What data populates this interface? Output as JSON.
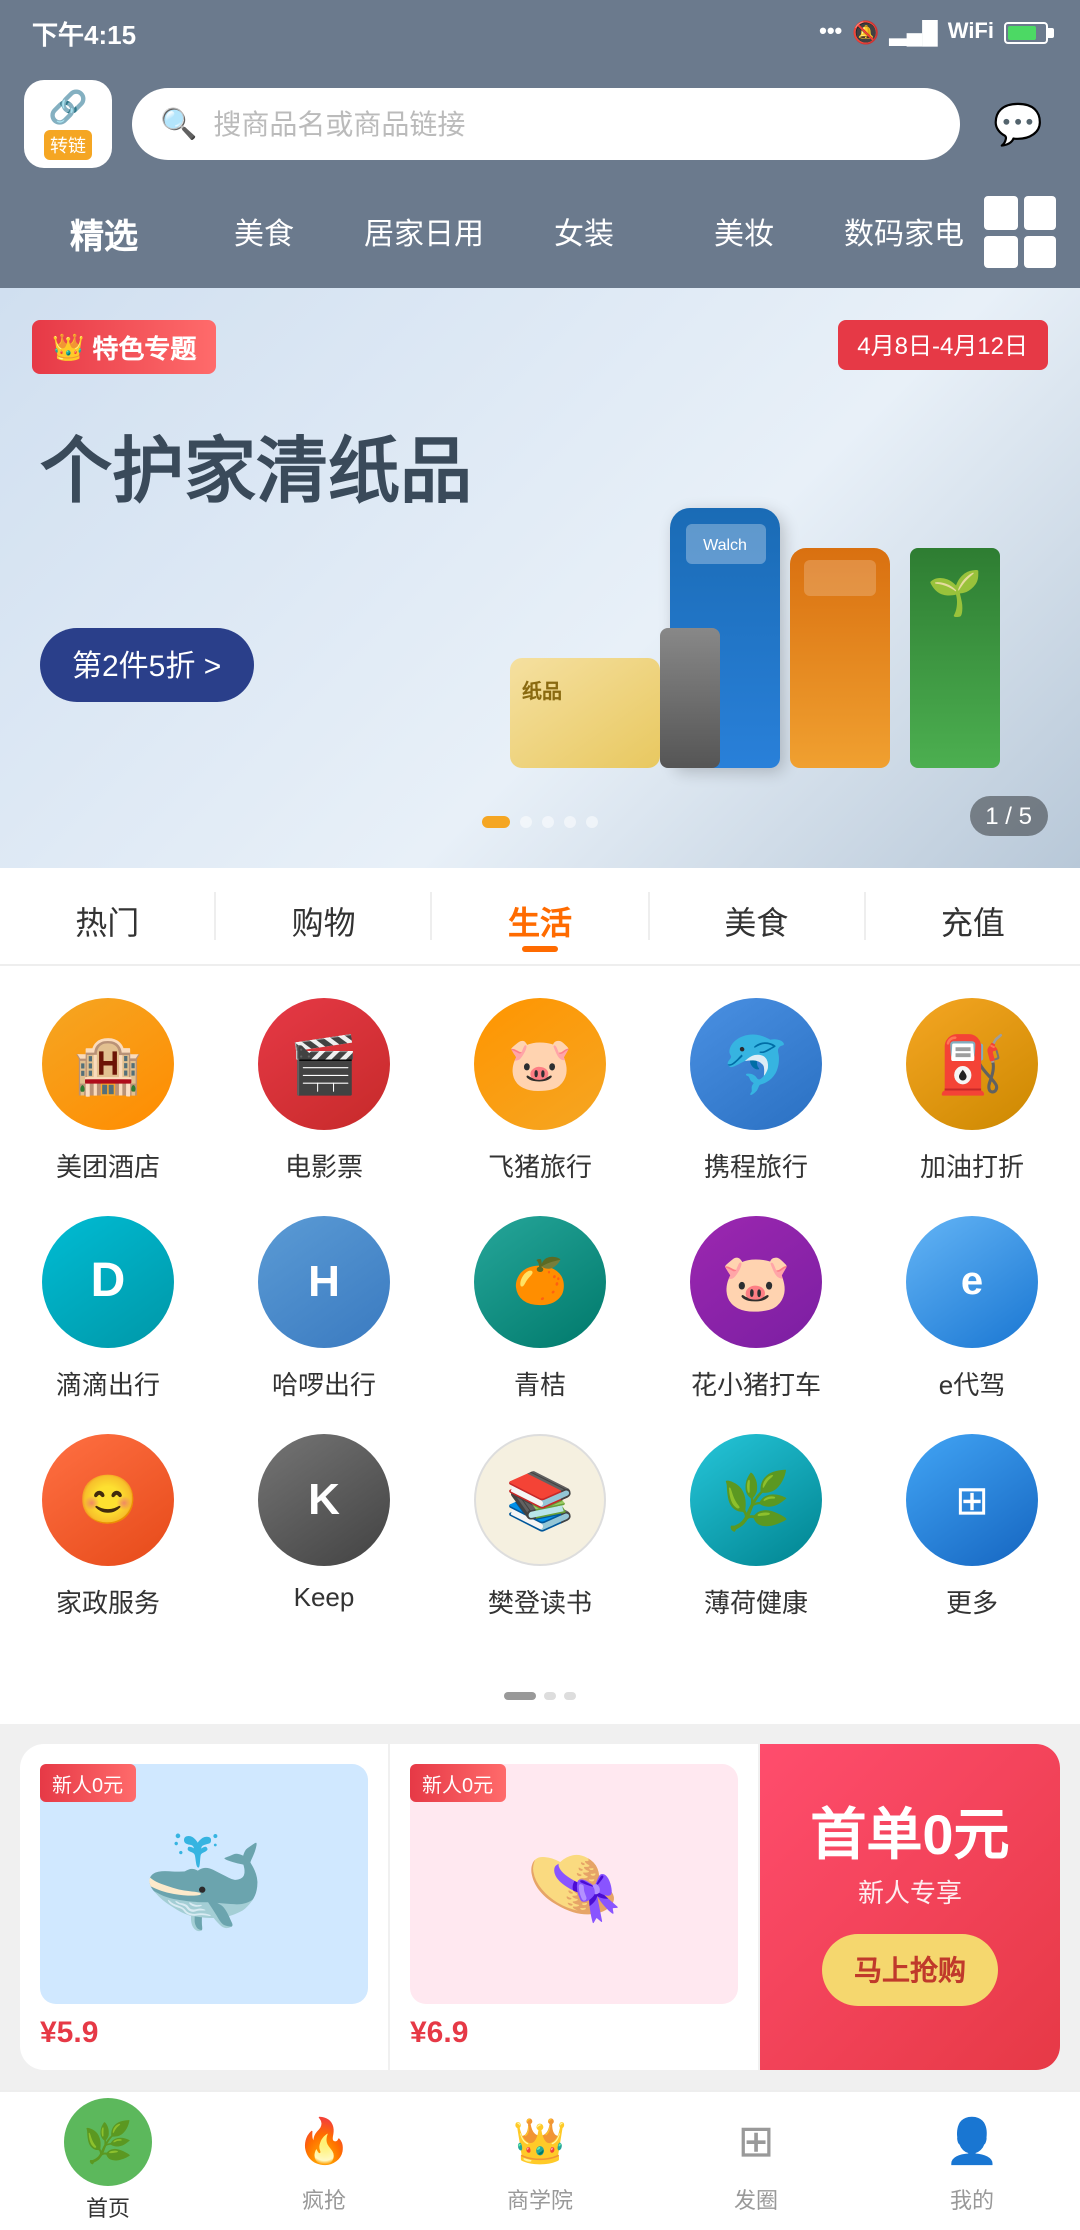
{
  "statusBar": {
    "time": "下午4:15",
    "icons": [
      "dots",
      "bell-off",
      "signal",
      "wifi",
      "battery"
    ]
  },
  "header": {
    "logoText": "转链",
    "searchPlaceholder": "搜商品名或商品链接",
    "chatLabel": "消息"
  },
  "categoryTabs": [
    {
      "label": "精选",
      "active": true
    },
    {
      "label": "美食",
      "active": false
    },
    {
      "label": "居家日用",
      "active": false
    },
    {
      "label": "女装",
      "active": false
    },
    {
      "label": "美妆",
      "active": false
    },
    {
      "label": "数码家电",
      "active": false
    }
  ],
  "banner": {
    "tag": "特色专题",
    "dateRange": "4月8日-4月12日",
    "title": "个护家清纸品",
    "promo": "第2件5折 >",
    "counter": "1 / 5"
  },
  "sectionTabs": [
    {
      "label": "热门",
      "active": false
    },
    {
      "label": "购物",
      "active": false
    },
    {
      "label": "生活",
      "active": true
    },
    {
      "label": "美食",
      "active": false
    },
    {
      "label": "充值",
      "active": false
    }
  ],
  "services": [
    {
      "row": 1,
      "items": [
        {
          "id": "meituan",
          "label": "美团酒店",
          "icon": "🏨",
          "colorClass": "ic-orange"
        },
        {
          "id": "movie",
          "label": "电影票",
          "icon": "🎬",
          "colorClass": "ic-red"
        },
        {
          "id": "fliggy",
          "label": "飞猪旅行",
          "icon": "🐷",
          "colorClass": "ic-orange2"
        },
        {
          "id": "ctrip",
          "label": "携程旅行",
          "icon": "🐬",
          "colorClass": "ic-blue"
        },
        {
          "id": "fuel",
          "label": "加油打折",
          "icon": "⛽",
          "colorClass": "ic-yellow-dark"
        }
      ]
    },
    {
      "row": 2,
      "items": [
        {
          "id": "didi",
          "label": "滴滴出行",
          "icon": "🚗",
          "colorClass": "ic-teal"
        },
        {
          "id": "hellobike",
          "label": "哈啰出行",
          "icon": "🚲",
          "colorClass": "ic-blue2"
        },
        {
          "id": "qingju",
          "label": "青桔",
          "icon": "🟢",
          "colorClass": "ic-green"
        },
        {
          "id": "huaxiaozhudi",
          "label": "花小猪打车",
          "icon": "🐷",
          "colorClass": "ic-purple"
        },
        {
          "id": "edaijia",
          "label": "e代驾",
          "icon": "🚙",
          "colorClass": "ic-light-blue"
        }
      ]
    },
    {
      "row": 3,
      "items": [
        {
          "id": "jiajia",
          "label": "家政服务",
          "icon": "🏠",
          "colorClass": "ic-dark-orange"
        },
        {
          "id": "keep",
          "label": "Keep",
          "icon": "K",
          "colorClass": "ic-gray"
        },
        {
          "id": "fandeng",
          "label": "樊登读书",
          "icon": "📚",
          "colorClass": "ic-cream"
        },
        {
          "id": "mint",
          "label": "薄荷健康",
          "icon": "🌿",
          "colorClass": "ic-teal2"
        },
        {
          "id": "more",
          "label": "更多",
          "icon": "⊞",
          "colorClass": "ic-blue3"
        }
      ]
    }
  ],
  "products": [
    {
      "badge": "新人0元",
      "price": "¥5.9",
      "imgBg": "blue-bg"
    },
    {
      "badge": "新人0元",
      "price": "¥6.9",
      "imgBg": "pink-bg"
    }
  ],
  "promoCard": {
    "title": "首单0元",
    "sub": "新人专享",
    "btnLabel": "马上抢购"
  },
  "bottomNav": [
    {
      "id": "home",
      "label": "首页",
      "active": true,
      "icon": "home"
    },
    {
      "id": "flash",
      "label": "疯抢",
      "active": false,
      "icon": "fire"
    },
    {
      "id": "academy",
      "label": "商学院",
      "active": false,
      "icon": "crown"
    },
    {
      "id": "circle",
      "label": "发圈",
      "active": false,
      "icon": "apps"
    },
    {
      "id": "mine",
      "label": "我的",
      "active": false,
      "icon": "person"
    }
  ]
}
